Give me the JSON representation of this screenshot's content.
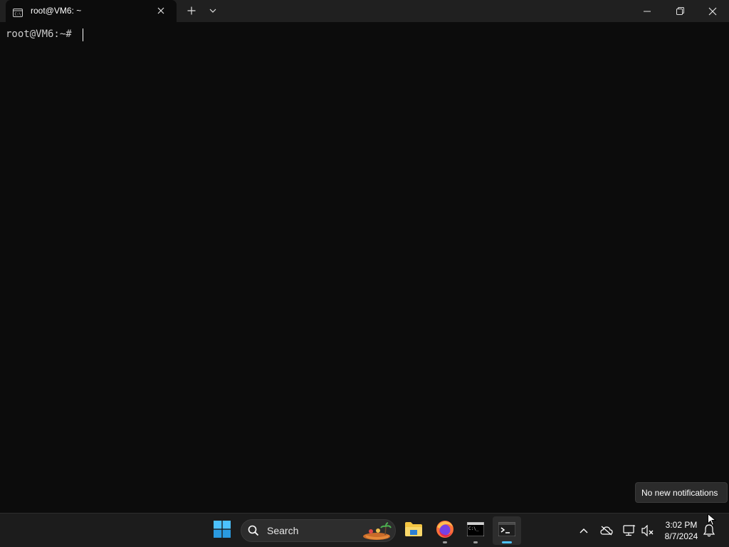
{
  "window": {
    "tab_title": "root@VM6: ~",
    "tab_icon": "terminal-tab-icon",
    "new_tab_icon": "plus-icon",
    "dropdown_icon": "chevron-down-icon",
    "minimize_icon": "minimize-icon",
    "maximize_icon": "restore-icon",
    "close_icon": "close-icon"
  },
  "terminal": {
    "prompt": "root@VM6:~# ",
    "text_color": "#cccccc",
    "background": "#0c0c0c"
  },
  "notification": {
    "text": "No new notifications"
  },
  "taskbar": {
    "search_placeholder": "Search",
    "apps": [
      {
        "name": "start",
        "icon": "windows-logo-icon"
      },
      {
        "name": "file-explorer",
        "icon": "folder-icon"
      },
      {
        "name": "firefox",
        "icon": "firefox-icon"
      },
      {
        "name": "command-prompt",
        "icon": "cmd-icon"
      },
      {
        "name": "terminal",
        "icon": "terminal-icon",
        "active": true
      }
    ],
    "tray": {
      "icons": [
        "chevron-up-icon",
        "cloud-off-icon",
        "network-icon",
        "volume-muted-icon"
      ],
      "time": "3:02 PM",
      "date": "8/7/2024",
      "notification_icon": "bell-icon"
    },
    "accent_color": "#4cc2ff"
  }
}
